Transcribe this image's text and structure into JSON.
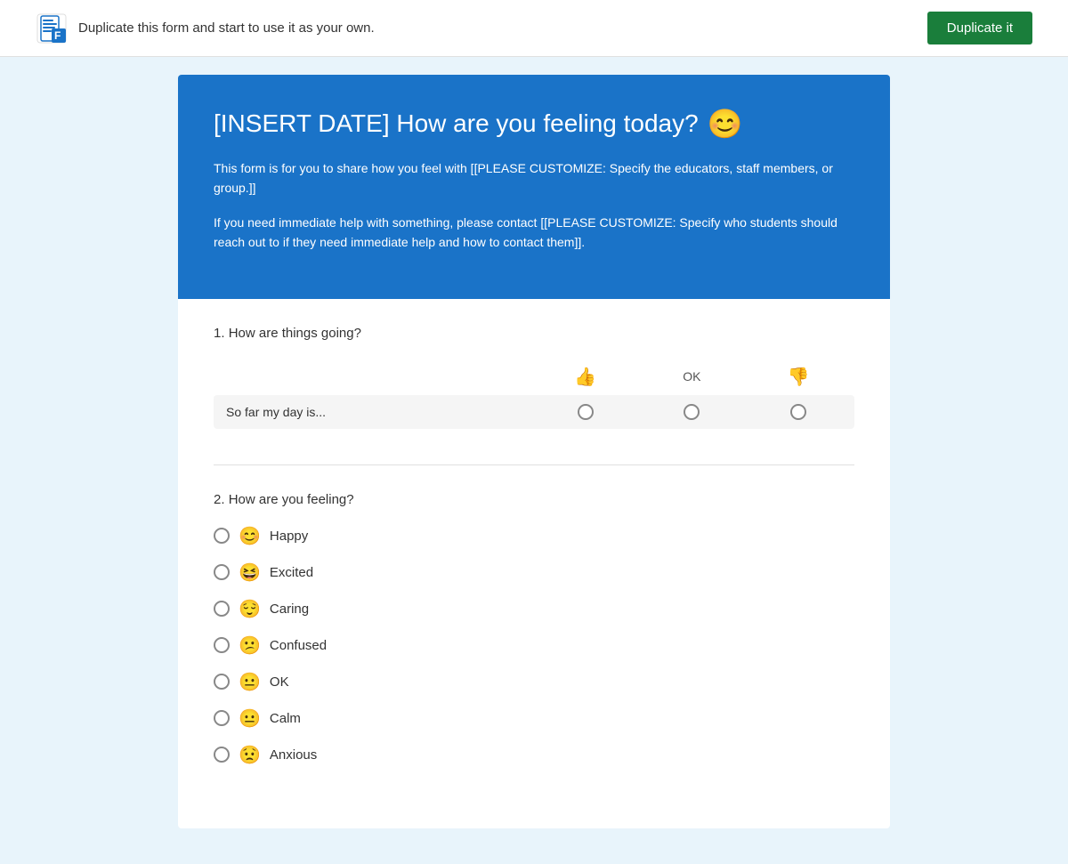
{
  "topBanner": {
    "text": "Duplicate this form and start to use it as your own.",
    "buttonLabel": "Duplicate it"
  },
  "form": {
    "title": "[INSERT DATE] How are you feeling today?",
    "titleEmoji": "😊",
    "description1": "This form is for you to share how you feel with [[PLEASE CUSTOMIZE: Specify the educators, staff members, or group.]]",
    "description2": "If you need immediate help with something, please contact [[PLEASE CUSTOMIZE: Specify who students should reach out to if they need immediate help and how to contact them]]."
  },
  "question1": {
    "number": "1.",
    "label": "How are things going?",
    "columns": [
      {
        "id": "good",
        "label": "",
        "emoji": "👍"
      },
      {
        "id": "ok",
        "label": "OK",
        "emoji": ""
      },
      {
        "id": "bad",
        "label": "",
        "emoji": "👎"
      }
    ],
    "rows": [
      {
        "id": "day",
        "label": "So far my day is..."
      }
    ]
  },
  "question2": {
    "number": "2.",
    "label": "How are you feeling?",
    "choices": [
      {
        "id": "happy",
        "label": "Happy",
        "emoji": "😊"
      },
      {
        "id": "excited",
        "label": "Excited",
        "emoji": "😆"
      },
      {
        "id": "caring",
        "label": "Caring",
        "emoji": "😌"
      },
      {
        "id": "confused",
        "label": "Confused",
        "emoji": "😕"
      },
      {
        "id": "ok",
        "label": "OK",
        "emoji": "😐"
      },
      {
        "id": "calm",
        "label": "Calm",
        "emoji": "😐"
      },
      {
        "id": "anxious",
        "label": "Anxious",
        "emoji": "😟"
      }
    ]
  }
}
